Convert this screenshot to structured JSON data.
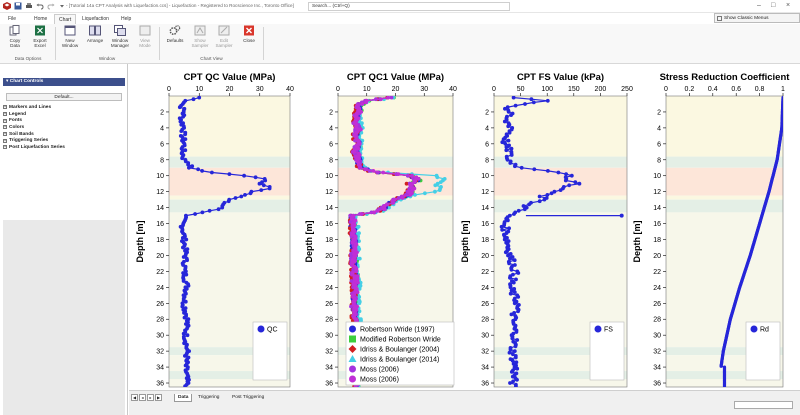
{
  "window": {
    "title": "- [Tutorial 14a CPT Analysis with Liquefaction.ccs] - Liquefaction - Registered to Rocscience Inc., Toronto Office]",
    "search_placeholder": "Search... (Ctrl+Q)",
    "classic_menus_label": "Show Classic Menus"
  },
  "ribbon": {
    "tabs": [
      {
        "label": "File"
      },
      {
        "label": "Home"
      },
      {
        "label": "Chart"
      },
      {
        "label": "Liquefaction"
      },
      {
        "label": "Help"
      }
    ],
    "active_tab": "Chart",
    "buttons": {
      "copy_data": "Copy Data",
      "export_excel": "Export Excel",
      "new_window": "New Window",
      "arrange": "Arrange",
      "window_manager": "Window Manager",
      "view_mode": "View Mode",
      "defaults": "Defaults",
      "show_sampler": "Show Sampler",
      "edit_sampler": "Edit Sampler",
      "close": "Close"
    },
    "groups": {
      "data_options": "Data Options",
      "window": "Window",
      "chart_view": "Chart View"
    }
  },
  "left_panel": {
    "header": "Chart Controls",
    "default_button": "Default...",
    "items": [
      {
        "label": "Markers and Lines"
      },
      {
        "label": "Legend"
      },
      {
        "label": "Fonts"
      },
      {
        "label": "Colors"
      },
      {
        "label": "Soil Bands"
      },
      {
        "label": "Triggering Series"
      },
      {
        "label": "Post Liquefaction Series"
      }
    ]
  },
  "sheet_tabs": {
    "tabs": [
      {
        "label": "Data"
      },
      {
        "label": "Triggering"
      },
      {
        "label": "Post Triggering"
      }
    ],
    "active": "Data"
  },
  "colors": {
    "blue": "#2626d9",
    "green": "#3ccf3c",
    "red": "#d22020",
    "cyan": "#45cfe6",
    "purple": "#a533e0",
    "magenta": "#c02fd6",
    "band_yellow": "#fbf8e1",
    "band_teal": "#e4efe6",
    "band_salmon": "#fde6d9",
    "band_pale": "#f7f7ea"
  },
  "chart_data": [
    {
      "type": "scatter",
      "title": "CPT QC Value (MPa)",
      "ylabel": "Depth [m]",
      "xlim": [
        0,
        40
      ],
      "ylim": [
        0,
        36.5
      ],
      "xticks": [
        0,
        10,
        20,
        30,
        40
      ],
      "yticks": [
        2,
        4,
        6,
        8,
        10,
        12,
        14,
        16,
        18,
        20,
        22,
        24,
        26,
        28,
        30,
        32,
        34,
        36
      ],
      "series": [
        {
          "name": "QC",
          "color": "blue",
          "profile": [
            [
              0.2,
              10
            ],
            [
              0.6,
              6
            ],
            [
              1.2,
              4
            ],
            [
              2.0,
              5
            ],
            [
              3.0,
              4
            ],
            [
              4.0,
              5
            ],
            [
              5.0,
              4.5
            ],
            [
              6.0,
              5
            ],
            [
              7.0,
              4.5
            ],
            [
              8.0,
              5
            ],
            [
              8.5,
              7
            ],
            [
              9.0,
              7
            ],
            [
              9.5,
              12
            ],
            [
              10.0,
              25
            ],
            [
              10.5,
              33
            ],
            [
              11.0,
              30
            ],
            [
              11.5,
              35
            ],
            [
              12.0,
              27
            ],
            [
              12.5,
              25
            ],
            [
              13.0,
              20
            ],
            [
              13.5,
              18
            ],
            [
              14.0,
              18
            ],
            [
              14.5,
              13
            ],
            [
              15.0,
              5
            ],
            [
              16.0,
              4.5
            ],
            [
              18.0,
              5
            ],
            [
              20.0,
              5.5
            ],
            [
              22.0,
              5
            ],
            [
              24.0,
              6
            ],
            [
              26.0,
              5
            ],
            [
              28.0,
              6
            ],
            [
              30.0,
              5.5
            ],
            [
              32.0,
              6
            ],
            [
              34.0,
              5.5
            ],
            [
              36.4,
              6
            ]
          ]
        }
      ]
    },
    {
      "type": "scatter",
      "title": "CPT QC1 Value (MPa)",
      "ylabel": "Depth [m]",
      "xlim": [
        0,
        40
      ],
      "ylim": [
        0,
        36.5
      ],
      "xticks": [
        0,
        10,
        20,
        30,
        40
      ],
      "yticks": [
        2,
        4,
        6,
        8,
        10,
        12,
        14,
        16,
        18,
        20,
        22,
        24,
        26,
        28,
        30,
        32,
        34,
        36
      ],
      "series": [
        {
          "name": "Robertson Wride (1997)",
          "color": "blue"
        },
        {
          "name": "Modified Robertson Wride",
          "color": "green"
        },
        {
          "name": "Idriss & Boulanger (2004)",
          "color": "red"
        },
        {
          "name": "Idriss & Boulanger (2014)",
          "color": "cyan"
        },
        {
          "name": "Moss (2006)",
          "color": "purple"
        },
        {
          "name": "Moss (2006)",
          "color": "magenta"
        }
      ],
      "profile": [
        [
          0.2,
          18
        ],
        [
          0.6,
          10
        ],
        [
          1.2,
          7
        ],
        [
          2.0,
          7
        ],
        [
          3.0,
          6
        ],
        [
          4.0,
          7
        ],
        [
          5.0,
          6
        ],
        [
          6.0,
          7
        ],
        [
          7.0,
          6
        ],
        [
          8.0,
          7
        ],
        [
          9.0,
          8
        ],
        [
          9.5,
          12
        ],
        [
          10.0,
          25
        ],
        [
          10.5,
          28
        ],
        [
          11.0,
          25
        ],
        [
          11.5,
          26
        ],
        [
          12.0,
          25
        ],
        [
          12.5,
          24
        ],
        [
          13.0,
          20
        ],
        [
          13.5,
          18
        ],
        [
          14.0,
          16
        ],
        [
          14.5,
          14
        ],
        [
          15.0,
          5
        ],
        [
          16.0,
          5
        ],
        [
          18.0,
          5.5
        ],
        [
          20.0,
          5.5
        ],
        [
          22.0,
          5.5
        ],
        [
          24.0,
          6
        ],
        [
          26.0,
          5.5
        ],
        [
          28.0,
          6
        ],
        [
          30.0,
          6
        ],
        [
          32.0,
          6.5
        ],
        [
          34.0,
          6
        ],
        [
          36.4,
          6.5
        ]
      ]
    },
    {
      "type": "scatter",
      "title": "CPT FS Value (kPa)",
      "ylabel": "Depth [m]",
      "xlim": [
        0,
        250
      ],
      "ylim": [
        0,
        36.5
      ],
      "xticks": [
        0,
        50,
        100,
        150,
        200,
        250
      ],
      "yticks": [
        2,
        4,
        6,
        8,
        10,
        12,
        14,
        16,
        18,
        20,
        22,
        24,
        26,
        28,
        30,
        32,
        34,
        36
      ],
      "series": [
        {
          "name": "FS",
          "color": "blue",
          "profile": [
            [
              0.2,
              40
            ],
            [
              0.6,
              100
            ],
            [
              1.0,
              60
            ],
            [
              1.5,
              20
            ],
            [
              2.0,
              30
            ],
            [
              3.0,
              20
            ],
            [
              4.0,
              35
            ],
            [
              5.0,
              25
            ],
            [
              6.0,
              20
            ],
            [
              7.0,
              30
            ],
            [
              8.0,
              25
            ],
            [
              9.0,
              50
            ],
            [
              9.5,
              120
            ],
            [
              10.0,
              150
            ],
            [
              10.5,
              125
            ],
            [
              11.0,
              160
            ],
            [
              11.5,
              130
            ],
            [
              12.0,
              120
            ],
            [
              12.5,
              90
            ],
            [
              13.0,
              100
            ],
            [
              13.5,
              60
            ],
            [
              14.0,
              60
            ],
            [
              14.5,
              50
            ],
            [
              15.0,
              25
            ],
            [
              16.0,
              20
            ],
            [
              18.0,
              25
            ],
            [
              20.0,
              30
            ],
            [
              22.0,
              40
            ],
            [
              24.0,
              30
            ],
            [
              26.0,
              45
            ],
            [
              28.0,
              35
            ],
            [
              30.0,
              40
            ],
            [
              32.0,
              35
            ],
            [
              34.0,
              40
            ],
            [
              36.4,
              35
            ]
          ]
        }
      ]
    },
    {
      "type": "scatter",
      "title": "Stress Reduction Coefficient",
      "ylabel": "Depth [m]",
      "xlim": [
        0,
        1
      ],
      "ylim": [
        0,
        36.5
      ],
      "xticks": [
        0,
        0.2,
        0.4,
        0.6,
        0.8,
        1
      ],
      "yticks": [
        2,
        4,
        6,
        8,
        10,
        12,
        14,
        16,
        18,
        20,
        22,
        24,
        26,
        28,
        30,
        32,
        34,
        36
      ],
      "series": [
        {
          "name": "Rd",
          "color": "blue",
          "profile": [
            [
              0.2,
              1.0
            ],
            [
              4.0,
              0.99
            ],
            [
              8.0,
              0.95
            ],
            [
              12.0,
              0.88
            ],
            [
              16.0,
              0.8
            ],
            [
              20.0,
              0.72
            ],
            [
              24.0,
              0.63
            ],
            [
              28.0,
              0.55
            ],
            [
              32.0,
              0.49
            ],
            [
              34.0,
              0.47
            ],
            [
              34.0,
              0.5
            ],
            [
              36.4,
              0.5
            ]
          ]
        }
      ]
    }
  ]
}
